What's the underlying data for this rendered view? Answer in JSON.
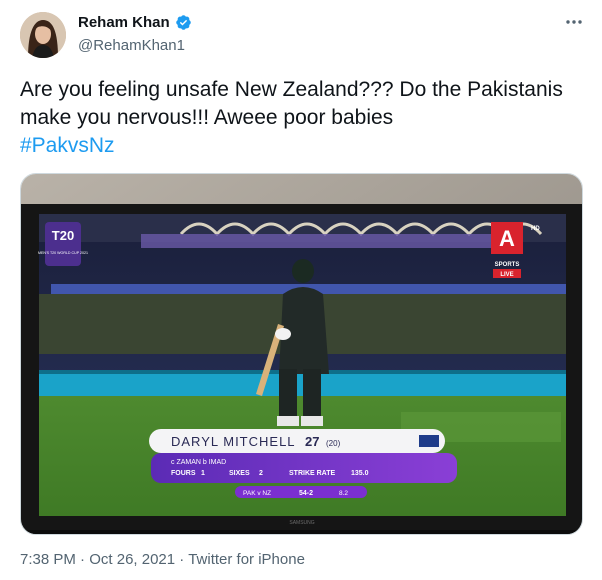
{
  "author": {
    "display_name": "Reham Khan",
    "handle": "@RehamKhan1",
    "verified": true
  },
  "tweet": {
    "text": "Are you feeling unsafe New Zealand??? Do the Pakistanis make you nervous!!! Aweee poor babies",
    "hashtag": "#PakvsNz"
  },
  "media": {
    "logo_t20": "T20",
    "logo_wc": "MEN'S T20 WORLD CUP 2021",
    "channel_letter": "A",
    "channel_hd": "HD",
    "channel_name": "SPORTS",
    "channel_live": "LIVE",
    "batter_name": "DARYL MITCHELL",
    "batter_runs": "27",
    "batter_balls": "(20)",
    "dismissal": "c ZAMAN b IMAD",
    "fours_label": "FOURS",
    "fours_value": "1",
    "sixes_label": "SIXES",
    "sixes_value": "2",
    "strike_rate_label": "STRIKE RATE",
    "strike_rate_value": "135.0",
    "match": "PAK v NZ",
    "score": "54-2",
    "overs": "8.2",
    "tv_brand": "SAMSUNG"
  },
  "footer": {
    "time": "7:38 PM",
    "separator1": " · ",
    "date": "Oct 26, 2021",
    "separator2": " · ",
    "source": "Twitter for iPhone"
  },
  "colors": {
    "link": "#1d9bf0",
    "verified": "#1d9bf0",
    "secondary_text": "#536471"
  }
}
